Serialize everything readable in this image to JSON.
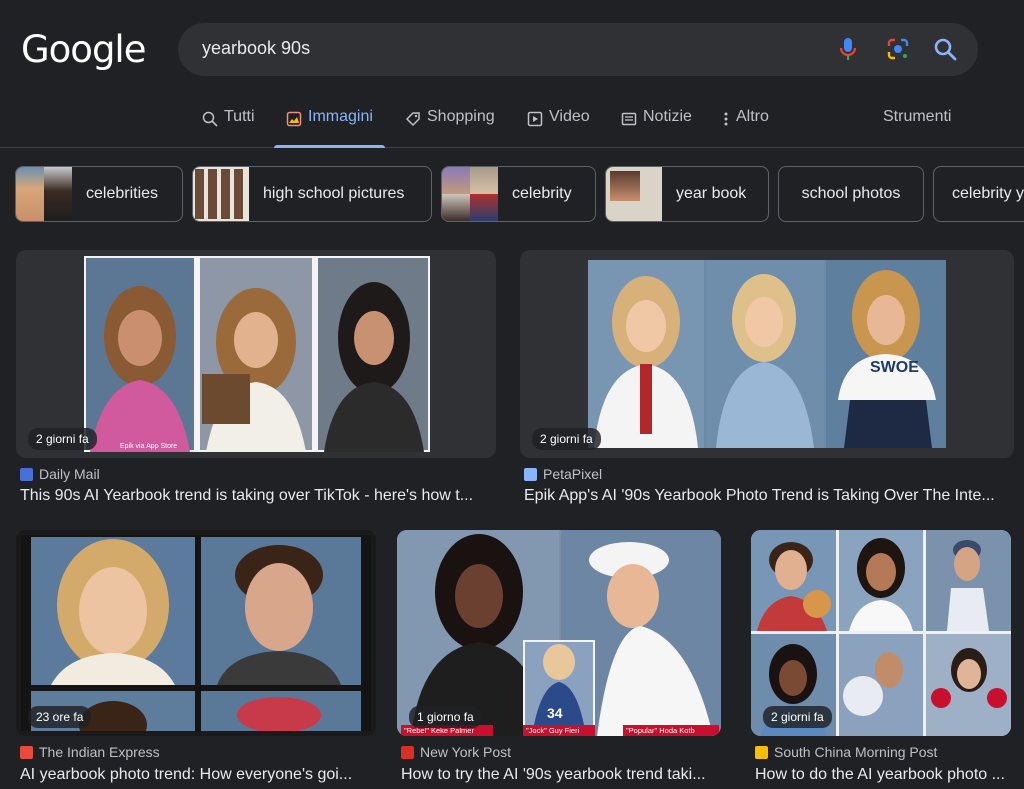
{
  "logo": "Google",
  "search": {
    "query": "yearbook 90s"
  },
  "tabs": [
    {
      "label": "Tutti",
      "icon": "search-icon"
    },
    {
      "label": "Immagini",
      "icon": "image-icon",
      "active": true
    },
    {
      "label": "Shopping",
      "icon": "tag-icon"
    },
    {
      "label": "Video",
      "icon": "play-icon"
    },
    {
      "label": "Notizie",
      "icon": "news-icon"
    },
    {
      "label": "Altro",
      "icon": "more-vert-icon"
    }
  ],
  "tools_label": "Strumenti",
  "chips": [
    "celebrities",
    "high school pictures",
    "celebrity",
    "year book",
    "school photos",
    "celebrity y"
  ],
  "results": [
    {
      "age": "2 giorni fa",
      "source": "Daily Mail",
      "title": "This 90s AI Yearbook trend is taking over TikTok - here's how t...",
      "favicon_color": "#4a6fd9"
    },
    {
      "age": "2 giorni fa",
      "source": "PetaPixel",
      "title": "Epik App's AI '90s Yearbook Photo Trend is Taking Over The Inte...",
      "favicon_color": "#8ab4f8"
    },
    {
      "age": "23 ore fa",
      "source": "The Indian Express",
      "title": "AI yearbook photo trend: How everyone's goi...",
      "favicon_color": "#e84a3c"
    },
    {
      "age": "1 giorno fa",
      "source": "New York Post",
      "title": "How to try the AI '90s yearbook trend taki...",
      "favicon_color": "#d93025"
    },
    {
      "age": "2 giorni fa",
      "source": "South China Morning Post",
      "title": "How to do the AI yearbook photo ...",
      "favicon_color": "#fbbc04"
    }
  ],
  "image_captions": {
    "dm_watermark": "Epik via App Store",
    "nyp_rebel": "\"Rebel\" Keke Palmer",
    "nyp_jock": "\"Jock\" Guy Fieri",
    "nyp_popular": "\"Popular\" Hoda Kotb",
    "pp_shirt": "SWOE",
    "nyp_jersey": "34"
  }
}
